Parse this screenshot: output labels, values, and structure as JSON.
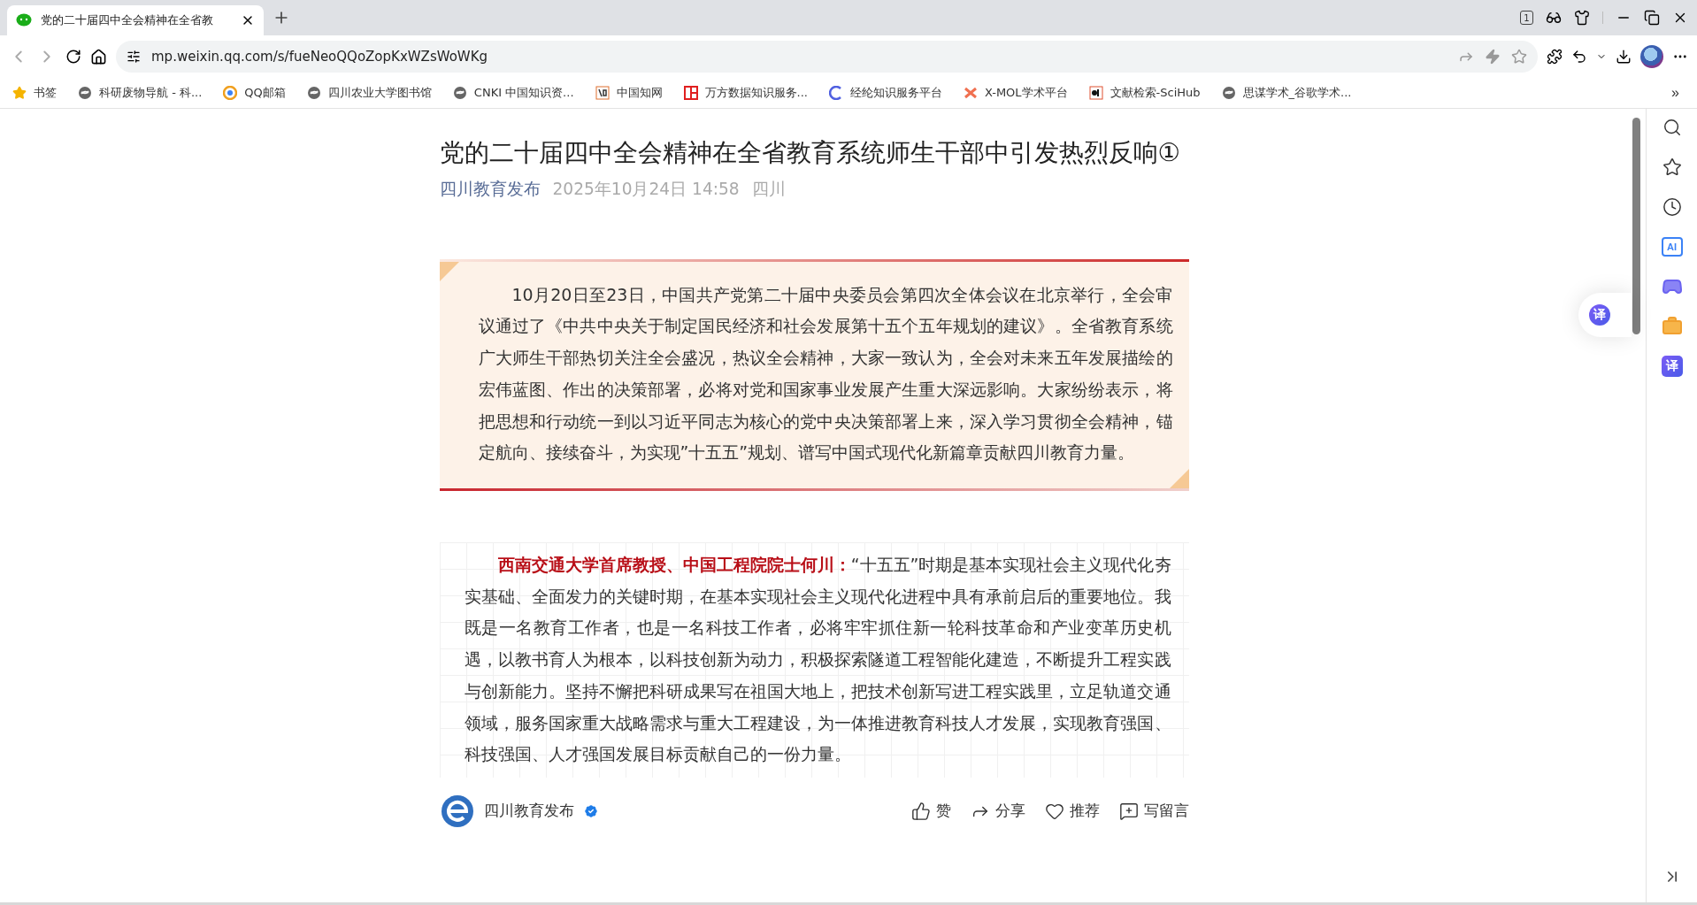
{
  "browser": {
    "tab": {
      "title": "党的二十届四中全会精神在全省教"
    },
    "tab_counter": "1",
    "url": "mp.weixin.qq.com/s/fueNeoQQoZopKxWZsWoWKg",
    "bookmarks": [
      {
        "label": "书签",
        "kind": "star"
      },
      {
        "label": "科研废物导航 - 科...",
        "kind": "swirl"
      },
      {
        "label": "QQ邮箱",
        "kind": "qq"
      },
      {
        "label": "四川农业大学图书馆",
        "kind": "swirl"
      },
      {
        "label": "CNKI 中国知识资...",
        "kind": "swirl"
      },
      {
        "label": "中国知网",
        "kind": "zhi"
      },
      {
        "label": "万方数据知识服务...",
        "kind": "wanfang"
      },
      {
        "label": "经纶知识服务平台",
        "kind": "ring"
      },
      {
        "label": "X-MOL学术平台",
        "kind": "x"
      },
      {
        "label": "文献检索-SciHub",
        "kind": "sci"
      },
      {
        "label": "思谋学术_谷歌学术...",
        "kind": "swirl"
      }
    ],
    "bookmarks_overflow": "»"
  },
  "article": {
    "title": "党的二十届四中全会精神在全省教育系统师生干部中引发热烈反响①",
    "account": "四川教育发布",
    "date": "2025年10月24日 14:58",
    "location": "四川",
    "intro": "10月20日至23日，中国共产党第二十届中央委员会第四次全体会议在北京举行，全会审议通过了《中共中央关于制定国民经济和社会发展第十五个五年规划的建议》。全省教育系统广大师生干部热切关注全会盛况，热议全会精神，大家一致认为，全会对未来五年发展描绘的宏伟蓝图、作出的决策部署，必将对党和国家事业发展产生重大深远影响。大家纷纷表示，将把思想和行动统一到以习近平同志为核心的党中央决策部署上来，深入学习贯彻全会精神，锚定航向、接续奋斗，为实现”十五五”规划、谱写中国式现代化新篇章贡献四川教育力量。",
    "quote": "**西南交通大学首席教授、中国工程院院士何川：**“十五五”时期是基本实现社会主义现代化夯实基础、全面发力的关键时期，在基本实现社会主义现代化进程中具有承前启后的重要地位。我既是一名教育工作者，也是一名科技工作者，必将牢牢抓住新一轮科技革命和产业变革历史机遇，以教书育人为根本，以科技创新为动力，积极探索隧道工程智能化建造，不断提升工程实践与创新能力。坚持不懈把科研成果写在祖国大地上，把技术创新写进工程实践里，立足轨道交通领域，服务国家重大战略需求与重大工程建设，为一体推进教育科技人才发展，实现教育强国、科技强国、人才强国发展目标贡献自己的一份力量。"
  },
  "footer": {
    "account": "四川教育发布",
    "verified": true,
    "actions": [
      {
        "label": "赞",
        "kind": "like"
      },
      {
        "label": "分享",
        "kind": "share"
      },
      {
        "label": "推荐",
        "kind": "heart"
      },
      {
        "label": "写留言",
        "kind": "comment"
      }
    ]
  },
  "floating_translate": "译",
  "sidebar": [
    {
      "kind": "search"
    },
    {
      "kind": "favorites"
    },
    {
      "kind": "history"
    },
    {
      "kind": "ai",
      "label": "AI"
    },
    {
      "kind": "game"
    },
    {
      "kind": "toolbox"
    },
    {
      "kind": "translate",
      "label": "译"
    }
  ]
}
